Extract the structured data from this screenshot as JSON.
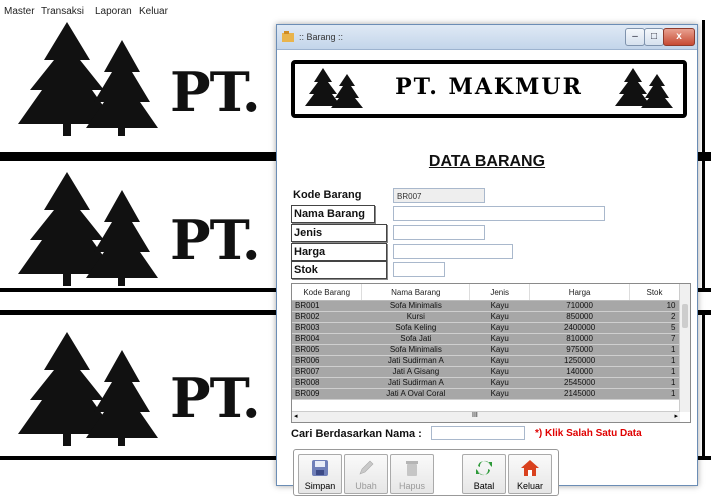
{
  "menu": [
    "Master",
    "Transaksi",
    "Laporan",
    "Keluar"
  ],
  "banner_text": "PT.",
  "window": {
    "title": ":: Barang ::",
    "logo_text": "PT. MAKMUR",
    "heading": "DATA BARANG"
  },
  "form": {
    "kode_label": "Kode Barang",
    "kode_value": "BR007",
    "nama_label": "Nama Barang",
    "jenis_label": "Jenis",
    "harga_label": "Harga",
    "stok_label": "Stok"
  },
  "grid": {
    "headers": [
      "Kode Barang",
      "Nama Barang",
      "Jenis",
      "Harga",
      "Stok"
    ],
    "rows": [
      [
        "BR001",
        "Sofa Minimalis",
        "Kayu",
        "710000",
        "10"
      ],
      [
        "BR002",
        "Kursi",
        "Kayu",
        "850000",
        "2"
      ],
      [
        "BR003",
        "Sofa Keling",
        "Kayu",
        "2400000",
        "5"
      ],
      [
        "BR004",
        "Sofa Jati",
        "Kayu",
        "810000",
        "7"
      ],
      [
        "BR005",
        "Sofa Minimalis",
        "Kayu",
        "975000",
        "1"
      ],
      [
        "BR006",
        "Jati Sudirman A",
        "Kayu",
        "1250000",
        "1"
      ],
      [
        "BR007",
        "Jati A Gisang",
        "Kayu",
        "140000",
        "1"
      ],
      [
        "BR008",
        "Jati Sudirman A",
        "Kayu",
        "2545000",
        "1"
      ],
      [
        "BR009",
        "Jati A Oval Coral",
        "Kayu",
        "2145000",
        "1"
      ]
    ],
    "hscroll_label": "III"
  },
  "search": {
    "label": "Cari Berdasarkan Nama :",
    "hint": "*) Klik Salah Satu Data"
  },
  "buttons": {
    "simpan": "Simpan",
    "ubah": "Ubah",
    "hapus": "Hapus",
    "batal": "Batal",
    "keluar": "Keluar"
  },
  "colors": {
    "grid_row": "#a7a7a7",
    "hint": "#e00000",
    "title_gradient_top": "#dfe9f5"
  }
}
